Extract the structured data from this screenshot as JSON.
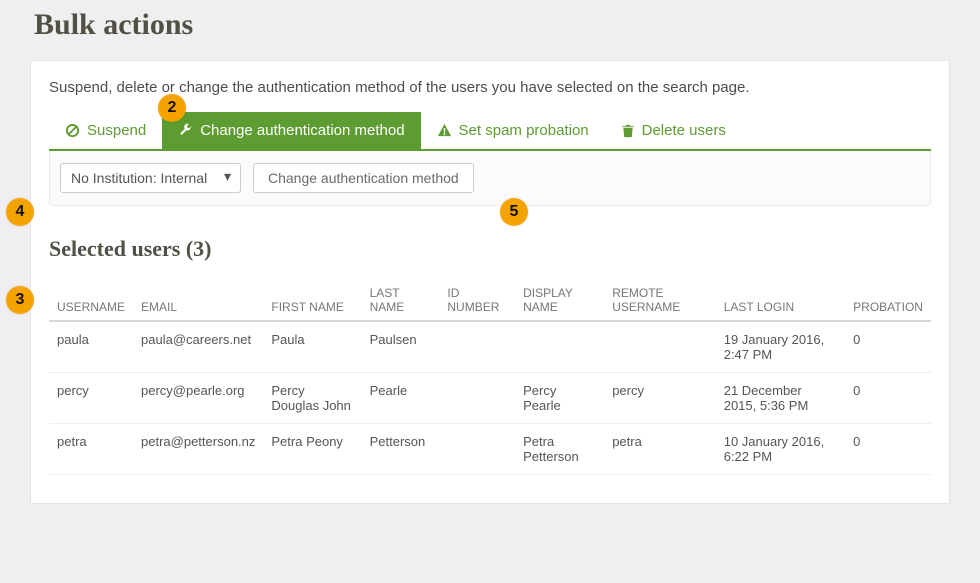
{
  "page": {
    "title": "Bulk actions"
  },
  "intro": "Suspend, delete or change the authentication method of the users you have selected on the search page.",
  "tabs": {
    "suspend": {
      "label": "Suspend",
      "active": false
    },
    "change_auth": {
      "label": "Change authentication method",
      "active": true
    },
    "spam_probation": {
      "label": "Set spam probation",
      "active": false
    },
    "delete_users": {
      "label": "Delete users",
      "active": false
    }
  },
  "form": {
    "institution_options": [
      "No Institution: Internal"
    ],
    "institution_selected": "No Institution: Internal",
    "submit_label": "Change authentication method"
  },
  "selected_users": {
    "title": "Selected users (3)",
    "count": 3,
    "columns": {
      "username": "USERNAME",
      "email": "EMAIL",
      "first_name": "FIRST NAME",
      "last_name": "LAST NAME",
      "id_number": "ID NUMBER",
      "display_name": "DISPLAY NAME",
      "remote_username": "REMOTE USERNAME",
      "last_login": "LAST LOGIN",
      "probation": "PROBATION"
    },
    "rows": [
      {
        "username": "paula",
        "email": "paula@careers.net",
        "first_name": "Paula",
        "last_name": "Paulsen",
        "id_number": "",
        "display_name": "",
        "remote_username": "",
        "last_login": "19 January 2016, 2:47 PM",
        "probation": "0"
      },
      {
        "username": "percy",
        "email": "percy@pearle.org",
        "first_name": "Percy Douglas John",
        "last_name": "Pearle",
        "id_number": "",
        "display_name": "Percy Pearle",
        "remote_username": "percy",
        "last_login": "21 December 2015, 5:36 PM",
        "probation": "0"
      },
      {
        "username": "petra",
        "email": "petra@petterson.nz",
        "first_name": "Petra Peony",
        "last_name": "Petterson",
        "id_number": "",
        "display_name": "Petra Petterson",
        "remote_username": "petra",
        "last_login": "10 January 2016, 6:22 PM",
        "probation": "0"
      }
    ]
  },
  "callouts": {
    "b2": "2",
    "b3": "3",
    "b4": "4",
    "b5": "5"
  }
}
